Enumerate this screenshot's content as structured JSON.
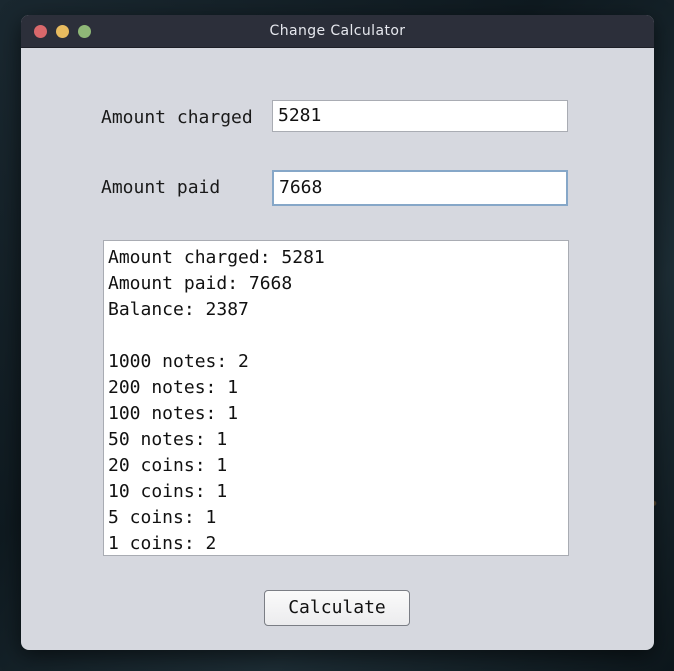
{
  "window": {
    "title": "Change Calculator"
  },
  "form": {
    "amount_charged_label": "Amount charged",
    "amount_charged_value": "5281",
    "amount_paid_label": "Amount paid",
    "amount_paid_value": "7668"
  },
  "output": {
    "summary": [
      "Amount charged: 5281",
      "Amount paid: 7668",
      "Balance: 2387"
    ],
    "breakdown": [
      "1000 notes: 2",
      "200 notes: 1",
      "100 notes: 1",
      "50 notes: 1",
      "20 coins: 1",
      "10 coins: 1",
      "5 coins: 1",
      "1 coins: 2"
    ]
  },
  "buttons": {
    "calculate_label": "Calculate"
  },
  "colors": {
    "window_bg": "#d6d8df",
    "titlebar_bg": "#2c2f3a",
    "close": "#d9686b",
    "minimize": "#e8bb5f",
    "maximize": "#8fb877",
    "focus_border": "#86a7c8"
  }
}
